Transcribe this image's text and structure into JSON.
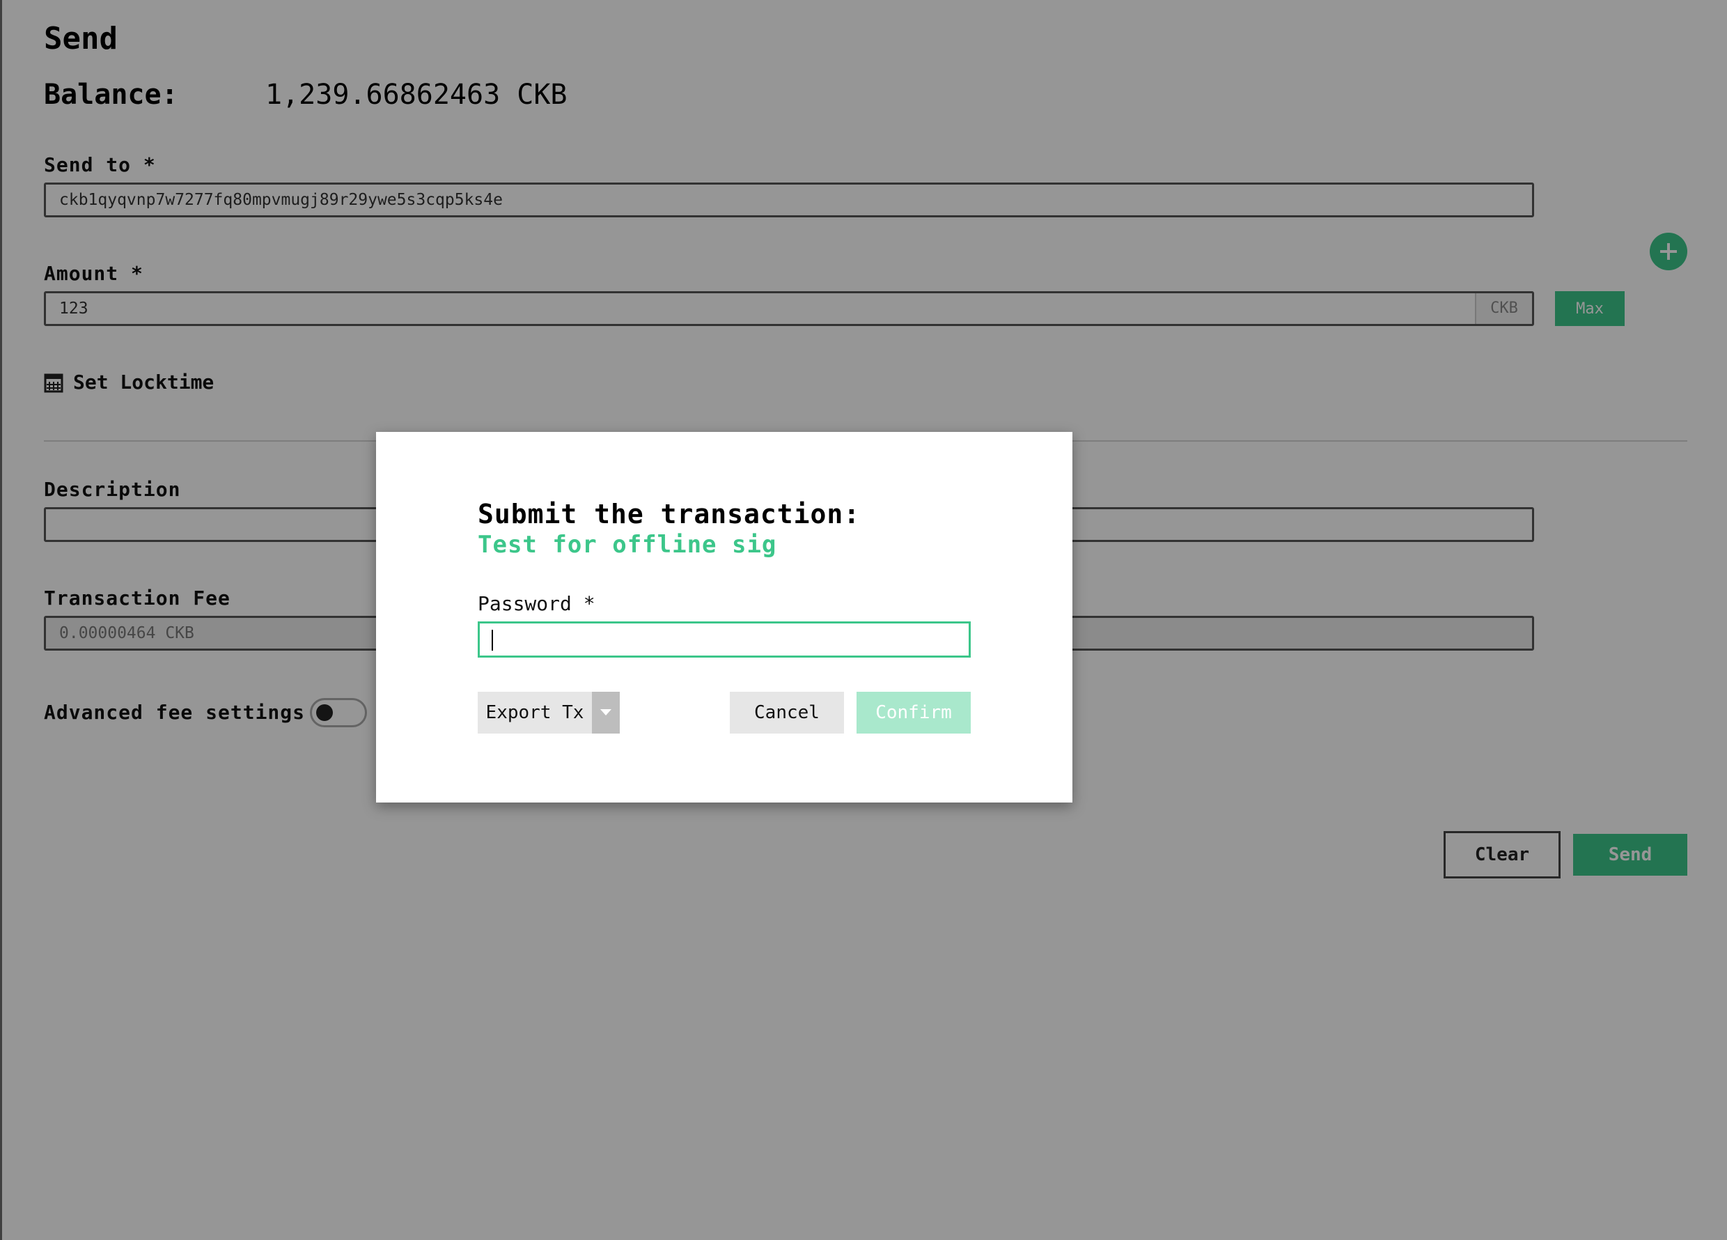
{
  "page": {
    "title": "Send",
    "balance_label": "Balance:",
    "balance_value": "1,239.66862463 CKB"
  },
  "form": {
    "send_to_label": "Send to *",
    "send_to_value": "ckb1qyqvnp7w7277fq80mpvmugj89r29ywe5s3cqp5ks4e",
    "amount_label": "Amount *",
    "amount_value": "123",
    "amount_unit": "CKB",
    "max_label": "Max",
    "locktime_label": "Set Locktime",
    "description_label": "Description",
    "description_value": "",
    "fee_label": "Transaction Fee",
    "fee_value": "0.00000464 CKB",
    "advanced_fee_label": "Advanced fee settings",
    "advanced_fee_enabled": false,
    "clear_label": "Clear",
    "send_label": "Send"
  },
  "dialog": {
    "title": "Submit the transaction:",
    "subtitle": "Test for offline sig",
    "password_label": "Password *",
    "password_value": "",
    "export_label": "Export Tx",
    "cancel_label": "Cancel",
    "confirm_label": "Confirm"
  },
  "colors": {
    "accent": "#3cc68a",
    "accent_disabled": "#a9e8cc",
    "overlay": "#000000"
  },
  "icons": {
    "add": "plus-icon",
    "locktime": "calendar-icon",
    "dropdown": "caret-down-icon"
  }
}
